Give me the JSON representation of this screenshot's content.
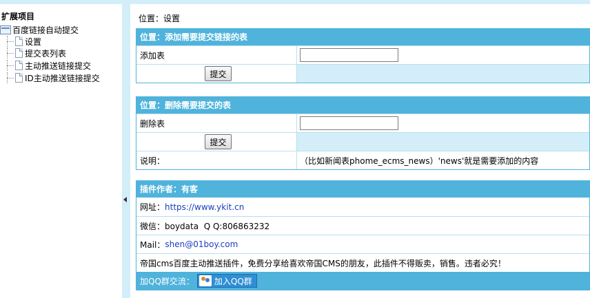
{
  "sidebar": {
    "title": "扩展项目",
    "root_label": "百度链接自动提交",
    "items": [
      {
        "label": "设置"
      },
      {
        "label": "提交表列表"
      },
      {
        "label": "主动推送链接提交"
      },
      {
        "label": "ID主动推送链接提交"
      }
    ]
  },
  "main": {
    "location": "位置：设置",
    "add_panel": {
      "header": "位置：添加需要提交链接的表",
      "field_label": "添加表",
      "field_value": "",
      "submit_label": "提交"
    },
    "delete_panel": {
      "header": "位置：删除需要提交的表",
      "field_label": "删除表",
      "field_value": "",
      "submit_label": "提交",
      "note_label": "说明：",
      "note_text": "（比如新闻表phome_ecms_news）'news'就是需要添加的内容"
    },
    "author_panel": {
      "header": "插件作者：有客",
      "website_label": "网址：",
      "website": "https://www.ykit.cn",
      "wechat": "微信：boydata  Q Q:806863232",
      "mail_label": "Mail：",
      "mail": "shen@01boy.com",
      "notice": "帝国cms百度主动推送插件，免费分享给喜欢帝国CMS的朋友，此插件不得贩卖，销售。违者必究！",
      "qq_group_label": "加QQ群交流：",
      "qq_button_label": "加入QQ群"
    }
  },
  "colors": {
    "accent": "#4fb3dc",
    "light_blue": "#d3eef8",
    "link": "#1a3dbf"
  }
}
